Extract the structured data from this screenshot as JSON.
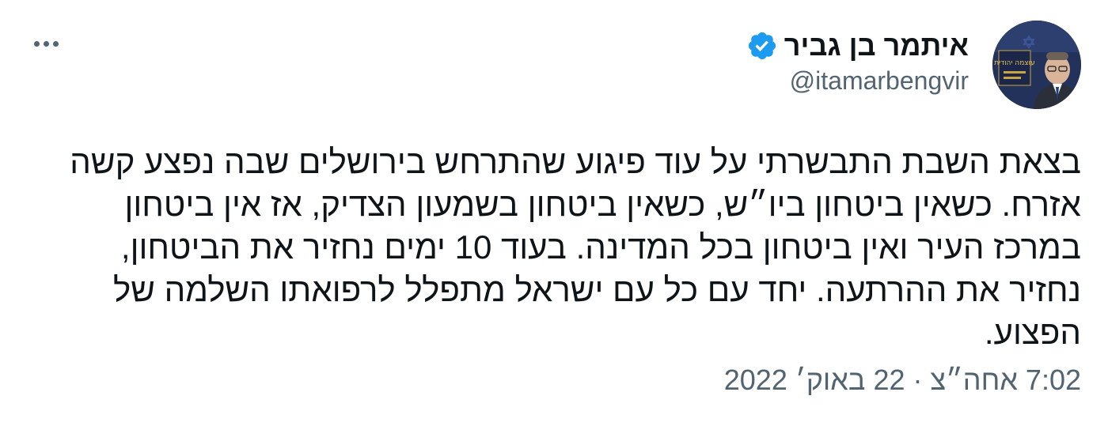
{
  "author": {
    "display_name": "איתמר בן גביר",
    "handle": "@itamarbengvir",
    "verified_icon": "verified-badge-icon",
    "avatar_icon": "profile-avatar",
    "avatar_sign_text": "עוצמה יהודית"
  },
  "menu": {
    "more_icon": "more-options-icon"
  },
  "tweet": {
    "lines": [
      "בצאת השבת התבשרתי על עוד פיגוע שהתרחש בירושלים שבה נפצע קשה",
      "אזרח. כשאין ביטחון ביו״ש, כשאין ביטחון בשמעון הצדיק, אז אין ביטחון",
      "במרכז העיר ואין ביטחון בכל המדינה. בעוד 10 ימים נחזיר את הביטחון,",
      "נחזיר את ההרתעה. יחד עם כל עם ישראל מתפלל לרפואתו השלמה של",
      "הפצוע."
    ],
    "timestamp": "7:02 אחה״צ · 22 באוק׳ 2022"
  },
  "colors": {
    "text_primary": "#0f1419",
    "text_secondary": "#536471",
    "verified_blue": "#1d9bf0"
  }
}
